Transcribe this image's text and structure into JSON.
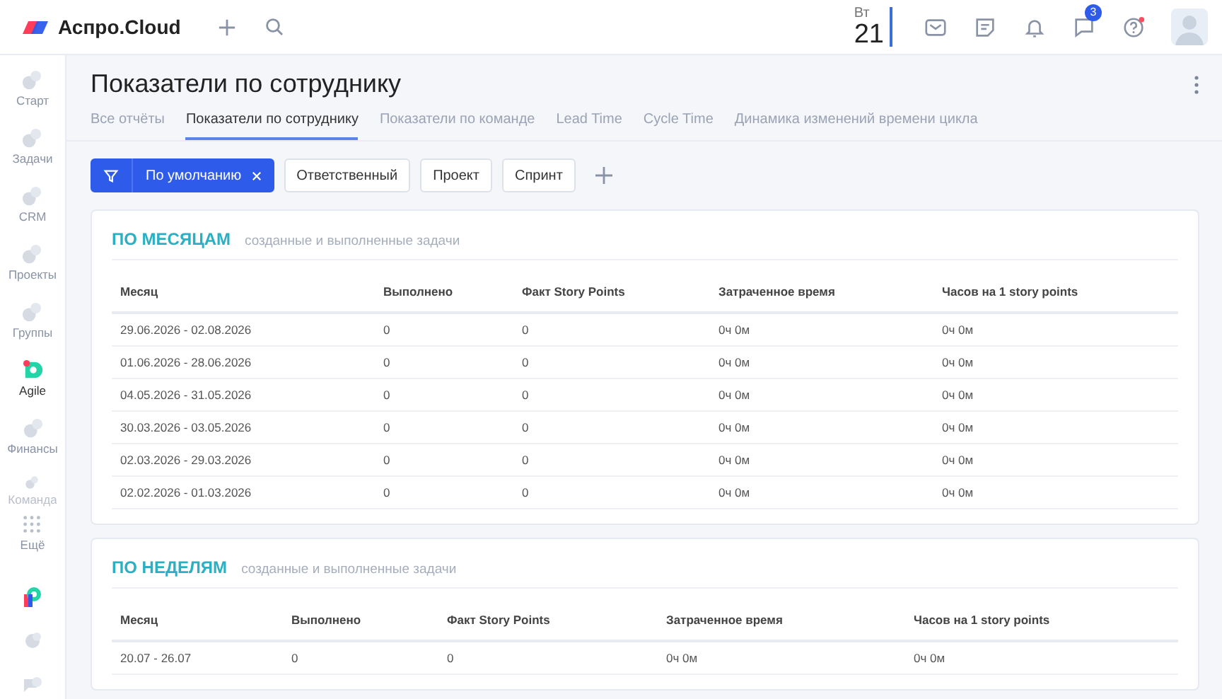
{
  "header": {
    "logo_text": "Аспро.Cloud",
    "date": {
      "weekday": "Вт",
      "day": "21"
    },
    "chat_badge": "3"
  },
  "sidebar": {
    "items": [
      {
        "label": "Старт",
        "selected": false
      },
      {
        "label": "Задачи",
        "selected": false
      },
      {
        "label": "CRM",
        "selected": false
      },
      {
        "label": "Проекты",
        "selected": false
      },
      {
        "label": "Группы",
        "selected": false
      },
      {
        "label": "Agile",
        "selected": true
      },
      {
        "label": "Финансы",
        "selected": false
      },
      {
        "label": "Команда",
        "selected": false
      },
      {
        "label": "Ещё",
        "selected": false
      }
    ]
  },
  "page": {
    "title": "Показатели по сотруднику",
    "tabs": [
      {
        "label": "Все отчёты",
        "selected": false
      },
      {
        "label": "Показатели по сотруднику",
        "selected": true
      },
      {
        "label": "Показатели по команде",
        "selected": false
      },
      {
        "label": "Lead Time",
        "selected": false
      },
      {
        "label": "Cycle Time",
        "selected": false
      },
      {
        "label": "Динамика изменений времени цикла",
        "selected": false
      }
    ],
    "filters": [
      {
        "label": "По умолчанию",
        "selected": true
      },
      {
        "label": "Ответственный",
        "selected": false
      },
      {
        "label": "Проект",
        "selected": false
      },
      {
        "label": "Спринт",
        "selected": false
      }
    ]
  },
  "sections": [
    {
      "title": "ПО МЕСЯЦАМ",
      "subtitle": "созданные и выполненные задачи",
      "columns": [
        "Месяц",
        "Выполнено",
        "Факт Story Points",
        "Затраченное время",
        "Часов на 1 story points"
      ],
      "rows": [
        [
          "29.06.2026 - 02.08.2026",
          "0",
          "0",
          "0ч 0м",
          "0ч 0м"
        ],
        [
          "01.06.2026 - 28.06.2026",
          "0",
          "0",
          "0ч 0м",
          "0ч 0м"
        ],
        [
          "04.05.2026 - 31.05.2026",
          "0",
          "0",
          "0ч 0м",
          "0ч 0м"
        ],
        [
          "30.03.2026 - 03.05.2026",
          "0",
          "0",
          "0ч 0м",
          "0ч 0м"
        ],
        [
          "02.03.2026 - 29.03.2026",
          "0",
          "0",
          "0ч 0м",
          "0ч 0м"
        ],
        [
          "02.02.2026 - 01.03.2026",
          "0",
          "0",
          "0ч 0м",
          "0ч 0м"
        ]
      ]
    },
    {
      "title": "ПО НЕДЕЛЯМ",
      "subtitle": "созданные и выполненные задачи",
      "columns": [
        "Месяц",
        "Выполнено",
        "Факт Story Points",
        "Затраченное время",
        "Часов на 1 story points"
      ],
      "rows": [
        [
          "20.07 - 26.07",
          "0",
          "0",
          "0ч 0м",
          "0ч 0м"
        ]
      ]
    }
  ]
}
